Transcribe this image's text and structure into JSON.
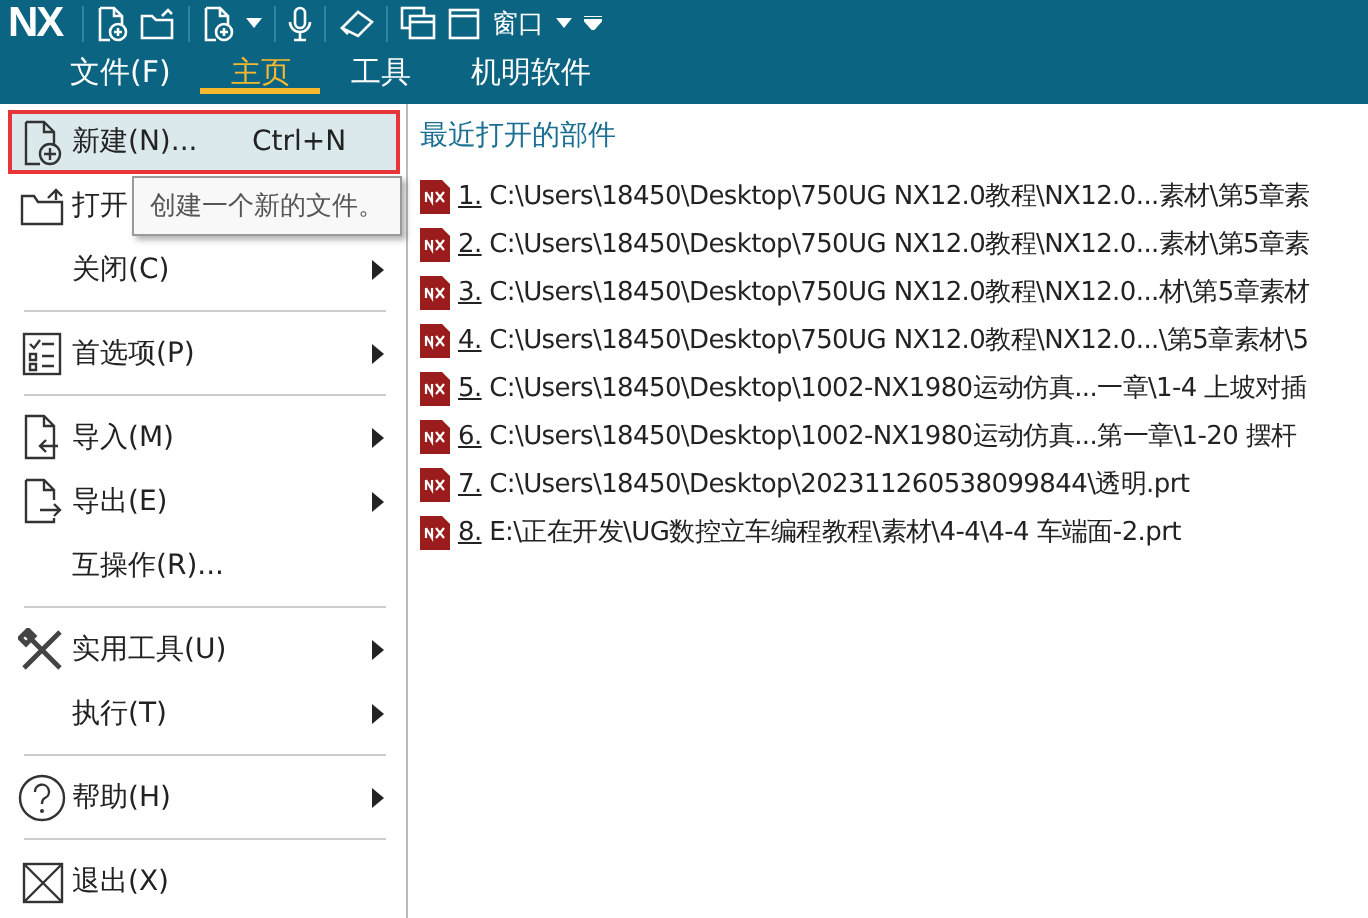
{
  "toolbar": {
    "logo": "NX",
    "window_menu": "窗口"
  },
  "tabs": [
    {
      "label": "文件(F)",
      "selected": false
    },
    {
      "label": "主页",
      "selected": true
    },
    {
      "label": "工具",
      "selected": false
    },
    {
      "label": "机明软件",
      "selected": false
    }
  ],
  "menu": {
    "groups": [
      [
        {
          "label": "新建(N)...",
          "shortcut": "Ctrl+N",
          "has_submenu": false,
          "selected": true
        },
        {
          "label": "打开",
          "has_submenu": false,
          "selected": false
        },
        {
          "label": "关闭(C)",
          "has_submenu": true,
          "selected": false
        }
      ],
      [
        {
          "label": "首选项(P)",
          "has_submenu": true,
          "selected": false
        }
      ],
      [
        {
          "label": "导入(M)",
          "has_submenu": true,
          "selected": false
        },
        {
          "label": "导出(E)",
          "has_submenu": true,
          "selected": false
        },
        {
          "label": "互操作(R)...",
          "has_submenu": false,
          "selected": false
        }
      ],
      [
        {
          "label": "实用工具(U)",
          "has_submenu": true,
          "selected": false
        },
        {
          "label": "执行(T)",
          "has_submenu": true,
          "selected": false
        }
      ],
      [
        {
          "label": "帮助(H)",
          "has_submenu": true,
          "selected": false
        }
      ],
      [
        {
          "label": "退出(X)",
          "has_submenu": false,
          "selected": false
        }
      ]
    ]
  },
  "tooltip": "创建一个新的文件。",
  "recent": {
    "title": "最近打开的部件",
    "files": [
      "1. C:\\Users\\18450\\Desktop\\750UG NX12.0教程\\NX12.0...素材\\第5章素",
      "2. C:\\Users\\18450\\Desktop\\750UG NX12.0教程\\NX12.0...素材\\第5章素",
      "3. C:\\Users\\18450\\Desktop\\750UG NX12.0教程\\NX12.0...材\\第5章素材",
      "4. C:\\Users\\18450\\Desktop\\750UG NX12.0教程\\NX12.0...\\第5章素材\\5",
      "5. C:\\Users\\18450\\Desktop\\1002-NX1980运动仿真...一章\\1-4 上坡对插",
      "6. C:\\Users\\18450\\Desktop\\1002-NX1980运动仿真...第一章\\1-20 摆杆",
      "7. C:\\Users\\18450\\Desktop\\202311260538099844\\透明.prt",
      "8. E:\\正在开发\\UG数控立车编程教程\\素材\\4-4\\4-4 车端面-2.prt"
    ]
  }
}
